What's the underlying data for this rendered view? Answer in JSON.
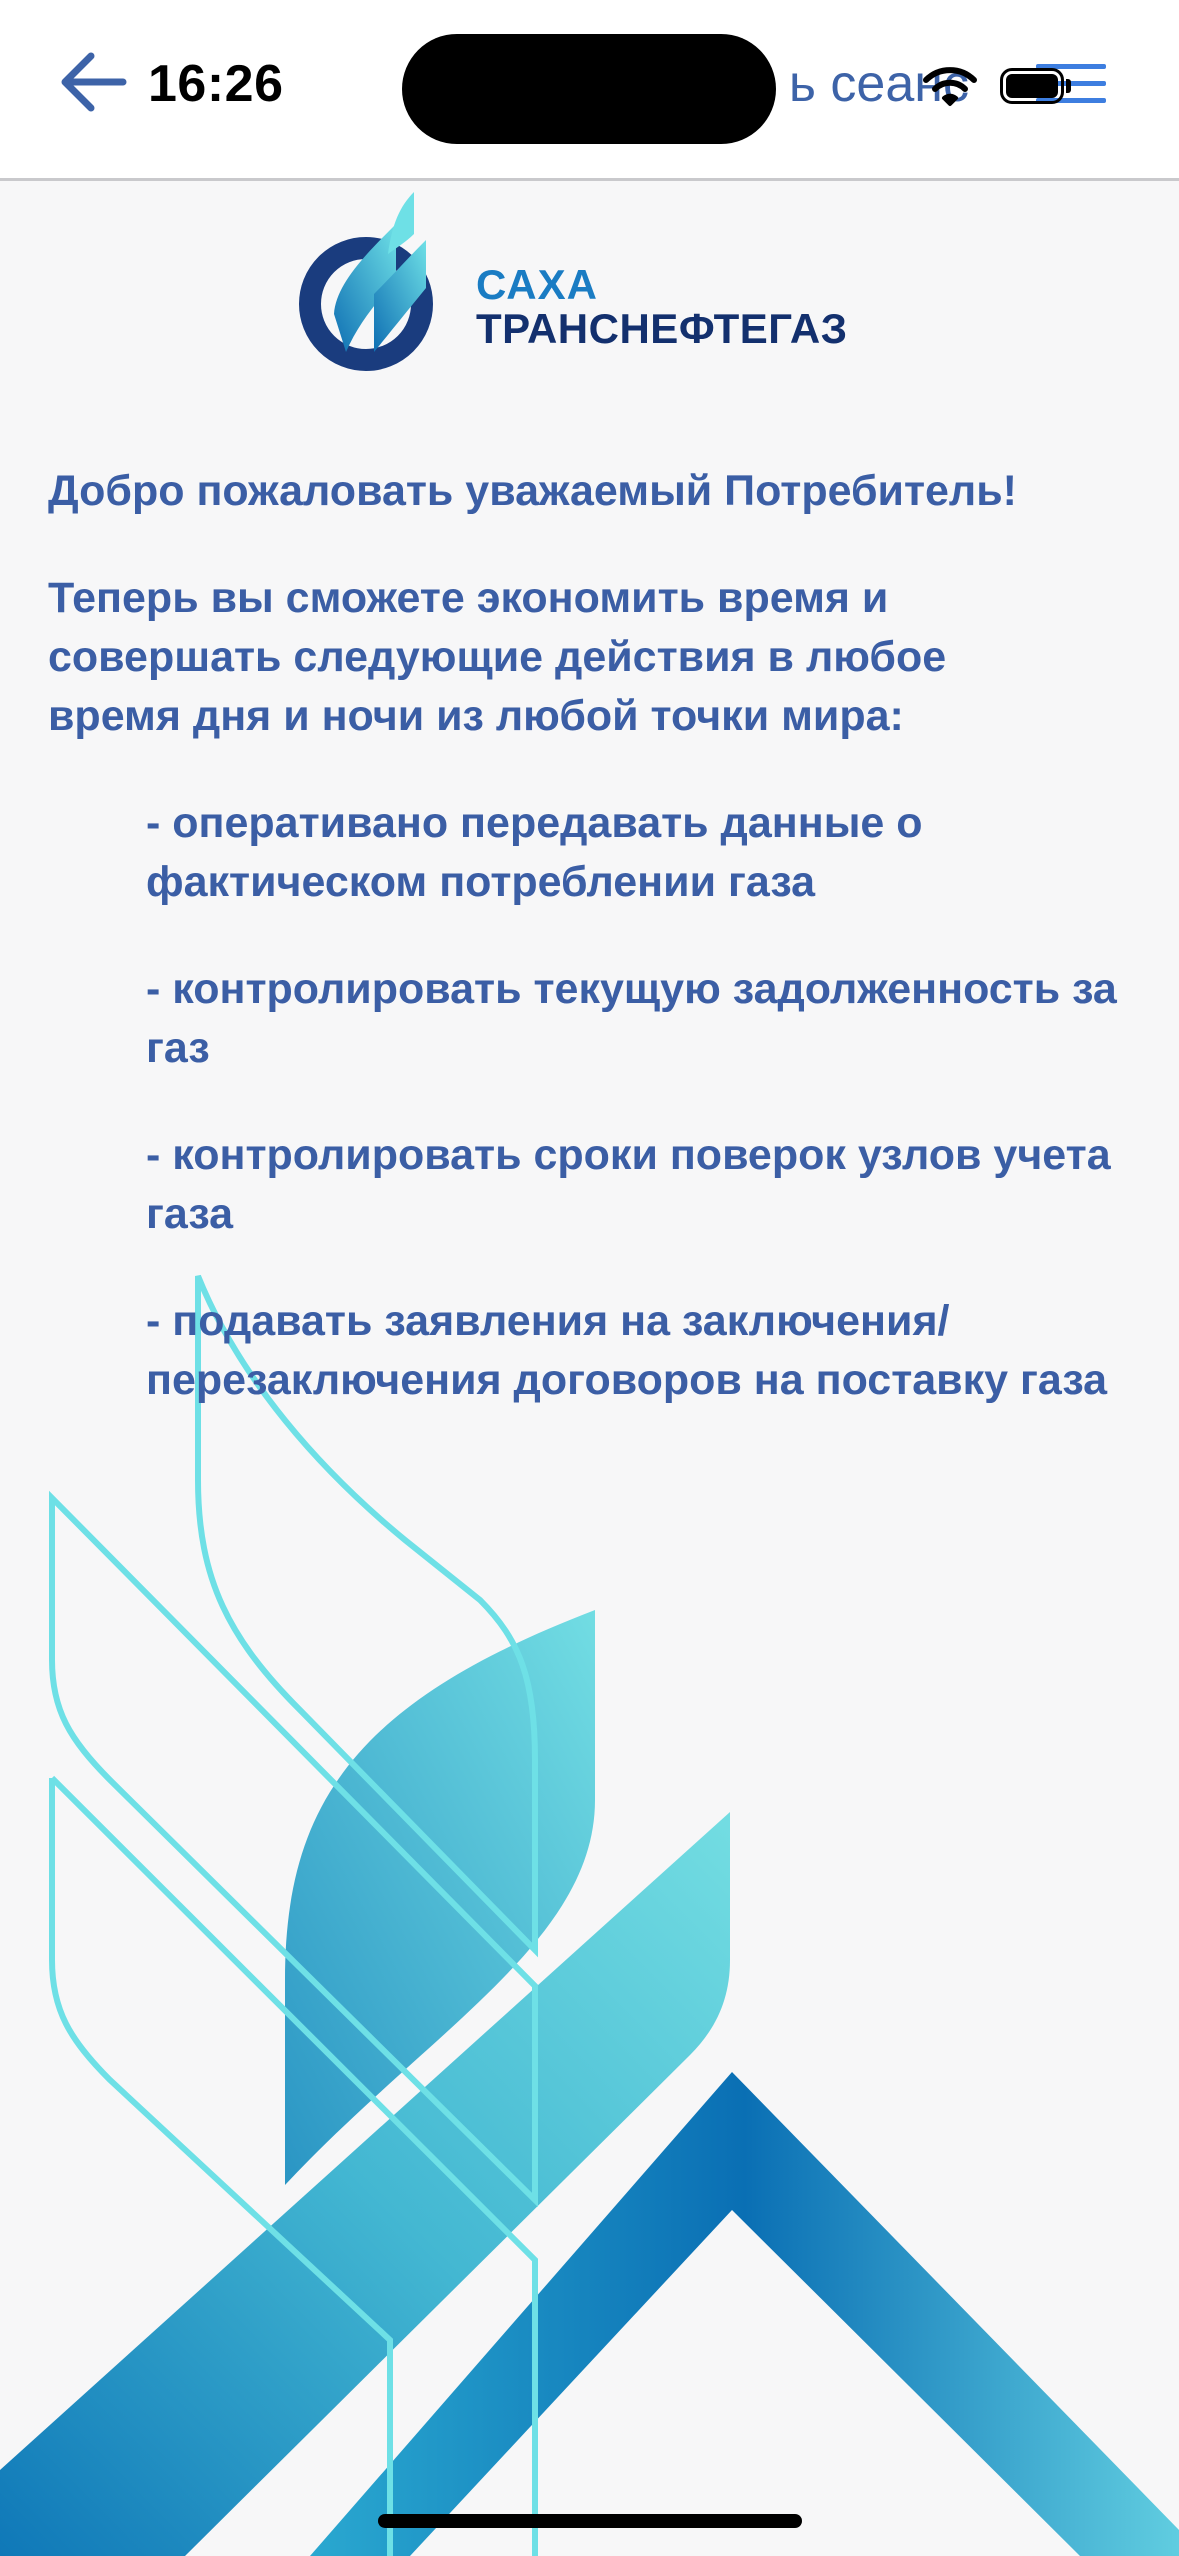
{
  "status_bar": {
    "time": "16:26"
  },
  "header": {
    "title_visible": "ь сеанс"
  },
  "logo": {
    "line1": "САХА",
    "line2": "ТРАНСНЕФТЕГАЗ"
  },
  "content": {
    "welcome": "Добро пожаловать уважаемый Потребитель!",
    "intro": "Теперь вы сможете экономить время и совершать следующие действия в любое время дня и ночи из любой точки мира:",
    "bullets": [
      "- оперативано передавать данные о фактическом потреблении газа",
      "- контролировать текущую задолженность за газ",
      "- контролировать сроки поверок узлов учета газа",
      "- подавать заявления на заключения/перезаключения договоров на поставку газа"
    ]
  },
  "colors": {
    "accent_blue": "#3b5ea5",
    "menu_blue": "#3d7ee0",
    "teal": "#6ee0e6",
    "deep_blue": "#0f6fb3",
    "navy": "#13306e"
  },
  "icons": [
    "back-arrow-icon",
    "wifi-icon",
    "battery-icon",
    "hamburger-menu-icon",
    "company-logo-icon"
  ]
}
